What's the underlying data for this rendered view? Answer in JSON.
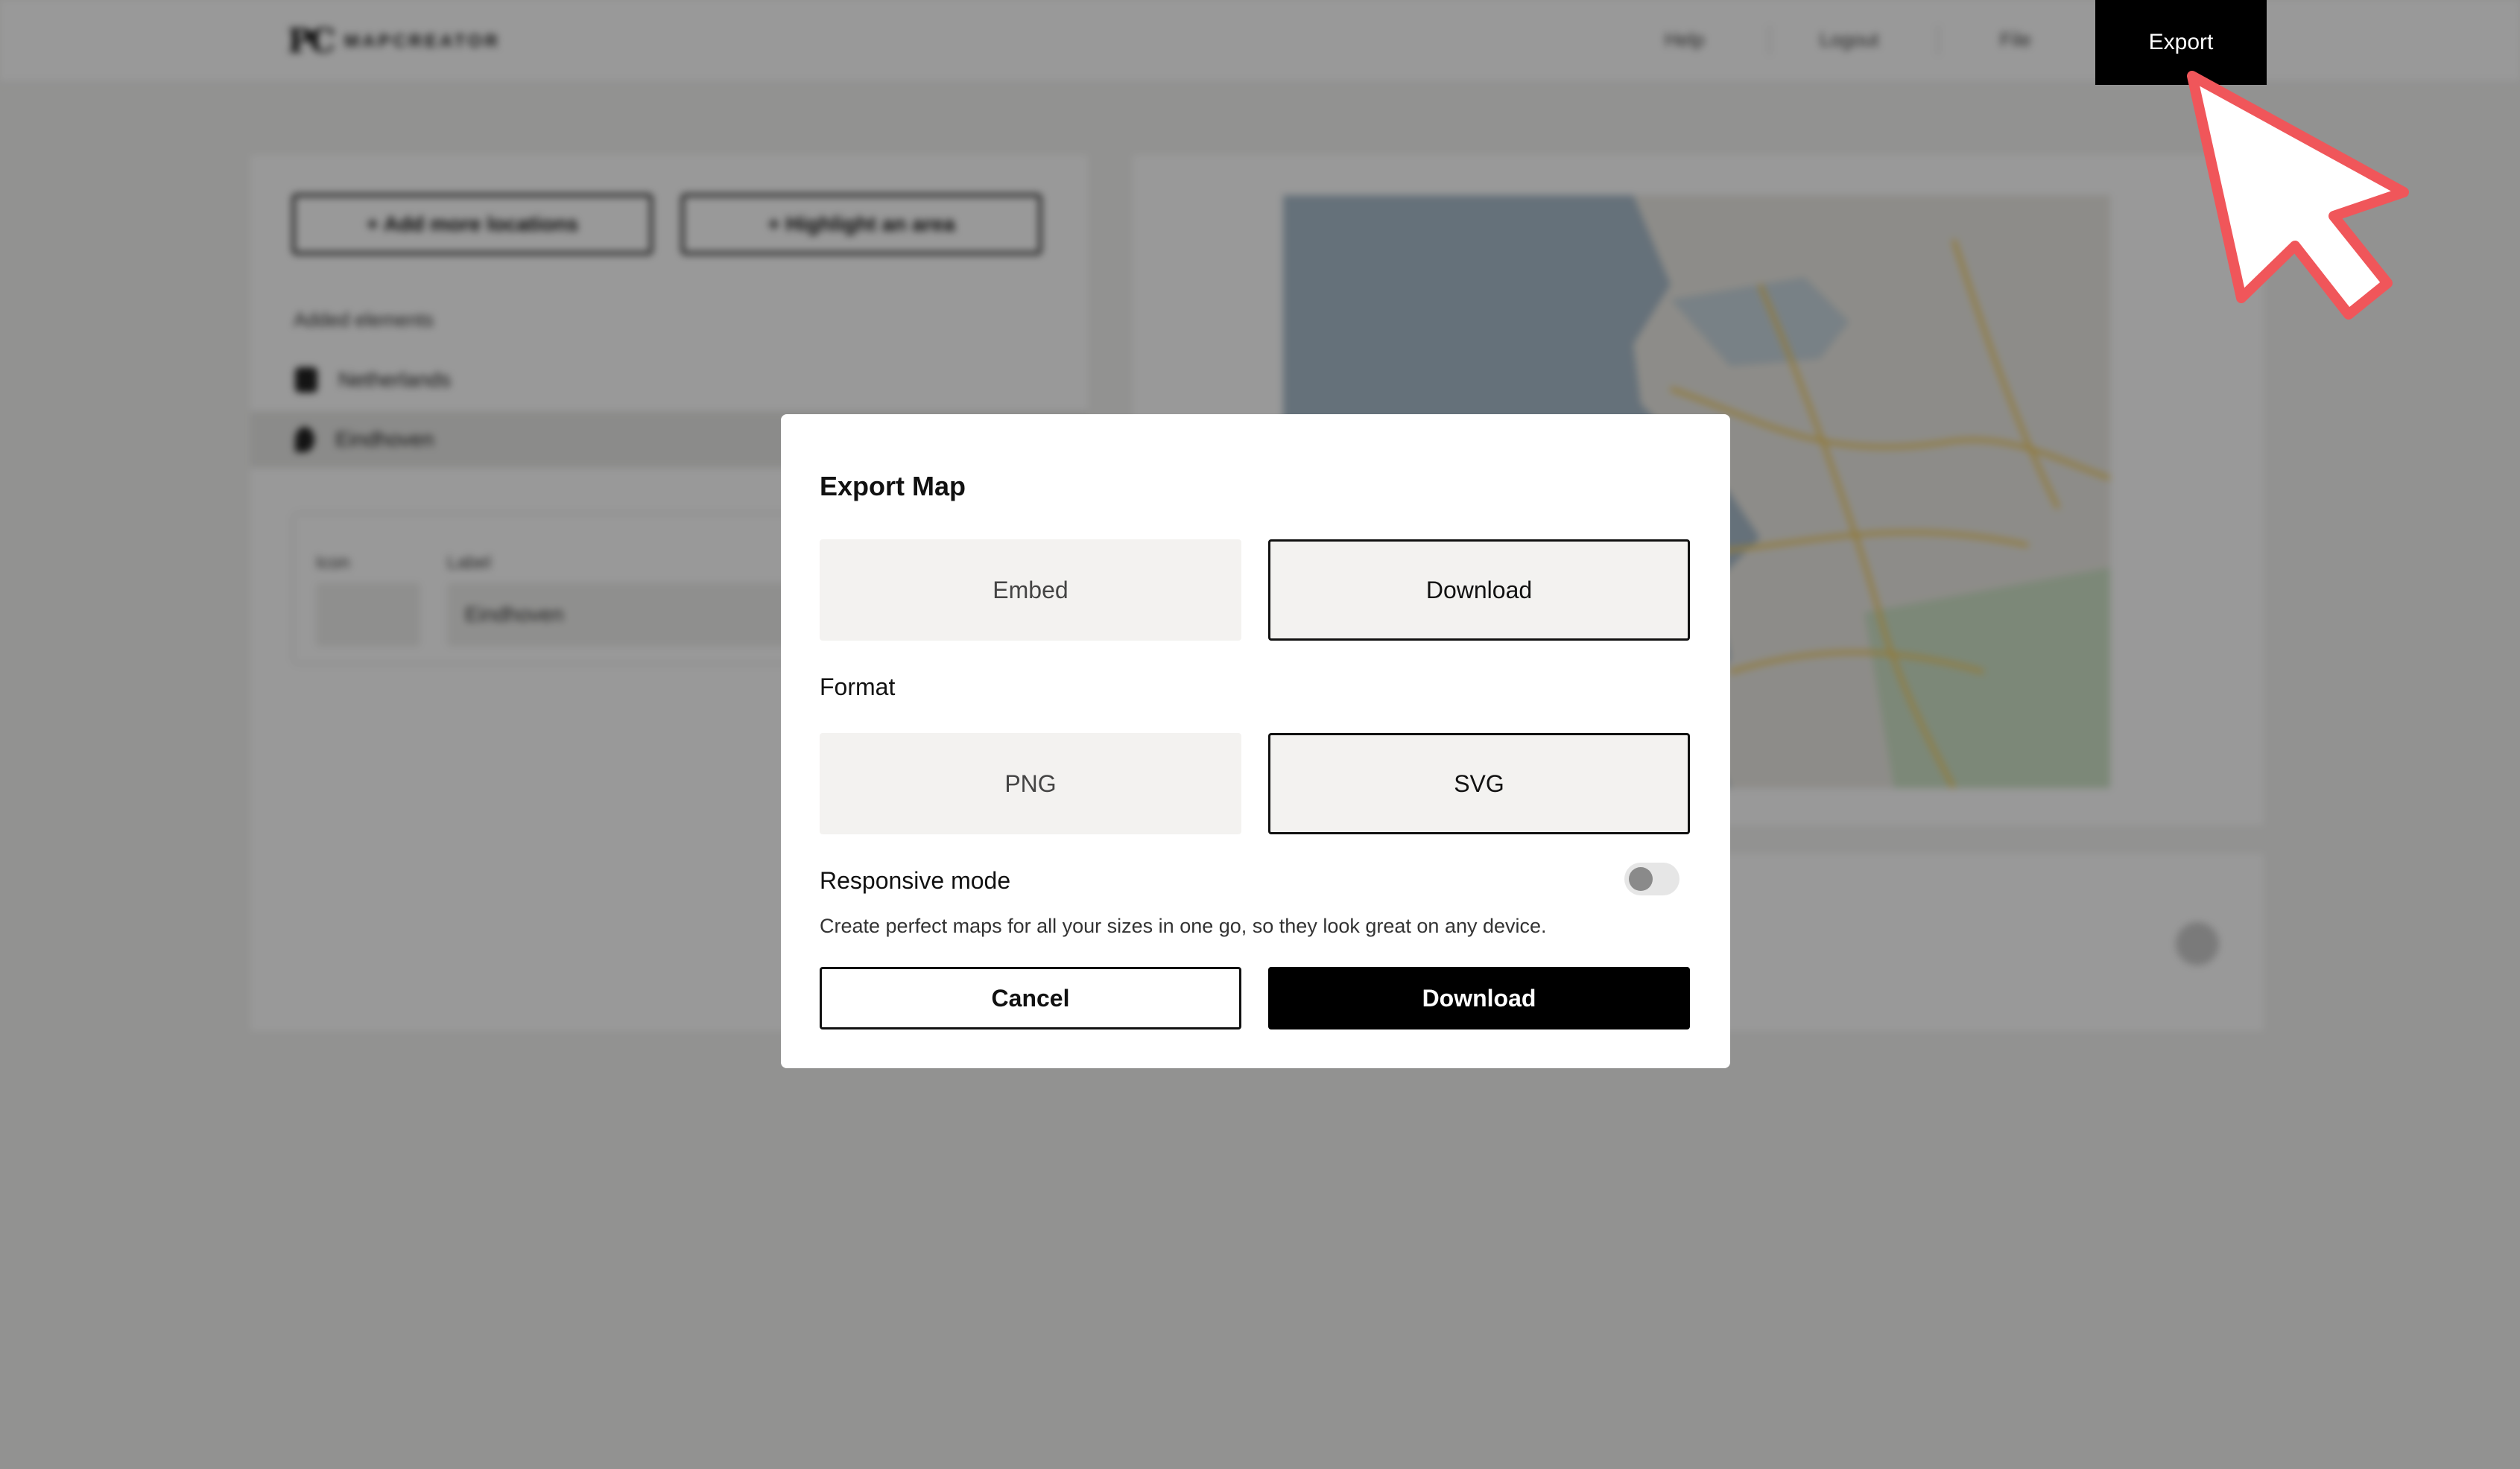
{
  "brand": {
    "logo_mark": "PC",
    "logo_text": "MAPCREATOR"
  },
  "nav": {
    "help": "Help",
    "logout": "Logout",
    "file": "File",
    "export": "Export"
  },
  "left_panel": {
    "add_locations": "+ Add more locations",
    "highlight_area": "+ Highlight an area",
    "section_title": "Added elements",
    "layers": [
      "Netherlands",
      "Eindhoven"
    ],
    "detail": {
      "icon_label": "Icon",
      "label_label": "Label",
      "label_value": "Eindhoven"
    }
  },
  "modal": {
    "title": "Export Map",
    "mode_options": [
      "Embed",
      "Download"
    ],
    "active_mode": "Download",
    "format_label": "Format",
    "format_options": [
      "PNG",
      "SVG"
    ],
    "active_format": "SVG",
    "responsive_label": "Responsive mode",
    "responsive_on": false,
    "responsive_help": "Create perfect maps for all your sizes in one go, so they look great on any device.",
    "cancel_label": "Cancel",
    "download_label": "Download"
  },
  "colors": {
    "primary": "#000000",
    "pointer_outline": "#f0565a",
    "overlay": "rgba(0,0,0,0.40)"
  },
  "icons": [
    "pointer-arrow-icon",
    "toggle-switch",
    "pin-icon",
    "polygon-icon"
  ]
}
